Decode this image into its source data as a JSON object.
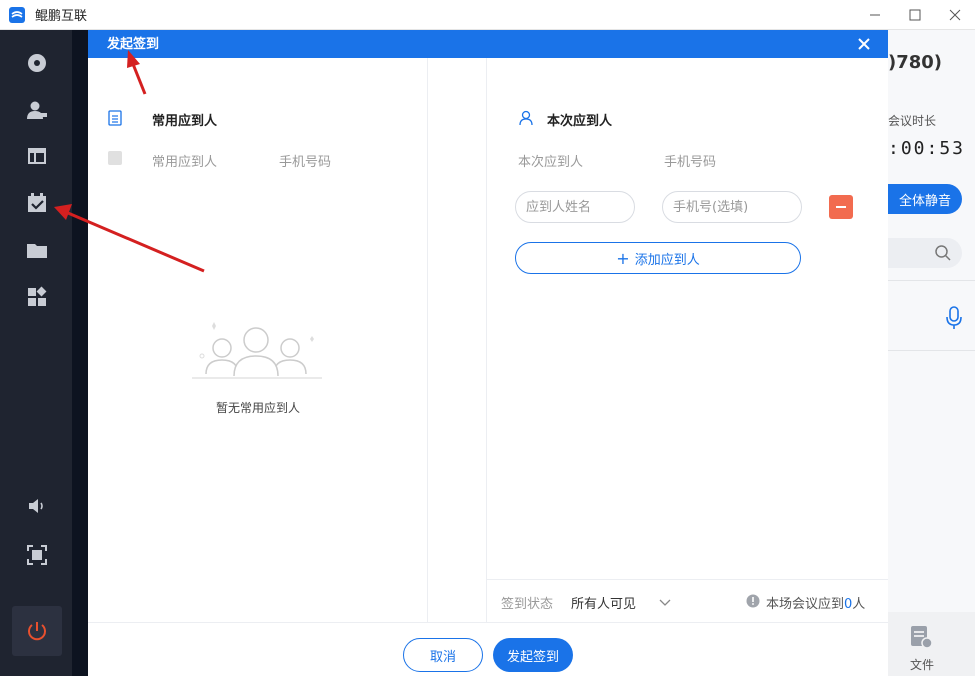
{
  "window": {
    "title": "鲲鹏互联",
    "minimize": "—",
    "maximize": "☐",
    "close": "✕"
  },
  "background": {
    "participant_count": ")780)",
    "duration_label": "会议时长",
    "timer": ":00:53",
    "mute_all": "全体静音",
    "file_label": "文件"
  },
  "dialog": {
    "title": "发起签到",
    "left": {
      "section_title": "常用应到人",
      "col_name": "常用应到人",
      "col_phone": "手机号码",
      "empty_text": "暂无常用应到人"
    },
    "right": {
      "section_title": "本次应到人",
      "col_name": "本次应到人",
      "col_phone": "手机号码",
      "name_placeholder": "应到人姓名",
      "phone_placeholder": "手机号(选填)",
      "add_button": "添加应到人"
    },
    "status": {
      "label": "签到状态",
      "value": "所有人可见",
      "note_prefix": "本场会议应到",
      "count": "0",
      "note_suffix": "人"
    },
    "footer": {
      "cancel": "取消",
      "start": "发起签到"
    }
  },
  "colors": {
    "primary": "#1a73e8",
    "danger": "#f26b4f",
    "sidebar": "#1f2430",
    "annotation": "#d42020"
  }
}
